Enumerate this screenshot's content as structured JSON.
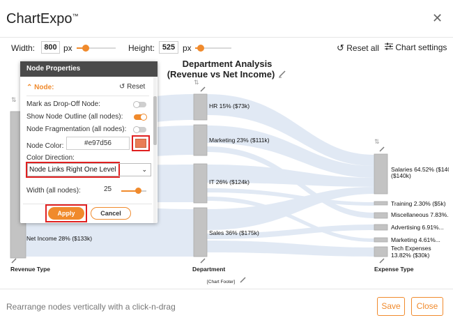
{
  "app": {
    "title": "ChartExpo",
    "trademark": "™"
  },
  "toolbar": {
    "width_label": "Width:",
    "width_value": "800",
    "width_unit": "px",
    "height_label": "Height:",
    "height_value": "525",
    "height_unit": "px",
    "reset_all": "Reset all",
    "chart_settings": "Chart settings"
  },
  "chart": {
    "title_line1": "Department Analysis",
    "title_line2": "(Revenue vs Net Income)",
    "footer": "[Chart Footer]",
    "axis_labels": [
      "Revenue Type",
      "Department",
      "Expense Type"
    ]
  },
  "chart_data": {
    "type": "sankey",
    "nodes": {
      "revenue_type": [
        "Net Income 28% ($133k)"
      ],
      "department": [
        "HR 15% ($73k)",
        "Marketing 23% ($111k)",
        "IT 26% ($124k)",
        "Sales 36% ($175k)"
      ],
      "expense_type": [
        "Salaries 64.52% ($140k)",
        "Training 2.30% ($5k)",
        "Miscellaneous 7.83%...",
        "Advertising 6.91%...",
        "Marketing 4.61%...",
        "Tech Expenses 13.82% ($30k)"
      ]
    }
  },
  "panel": {
    "title": "Node Properties",
    "section": "Node:",
    "reset": "Reset",
    "mark_dropoff": "Mark as Drop-Off Node:",
    "show_outline": "Show Node Outline (all nodes):",
    "fragmentation": "Node Fragmentation (all nodes):",
    "node_color_label": "Node Color:",
    "node_color_value": "#e97d56",
    "color_direction_label": "Color Direction:",
    "color_direction_value": "Node Links Right One Level",
    "width_label": "Width (all nodes):",
    "width_value": "25",
    "apply": "Apply",
    "cancel": "Cancel",
    "swatch_color": "#e97d56"
  },
  "footer": {
    "hint": "Rearrange nodes vertically with a click-n-drag",
    "save": "Save",
    "close": "Close"
  },
  "colors": {
    "accent": "#f08a2c",
    "highlight": "#e02020",
    "panel_head": "#4a4a4a"
  }
}
